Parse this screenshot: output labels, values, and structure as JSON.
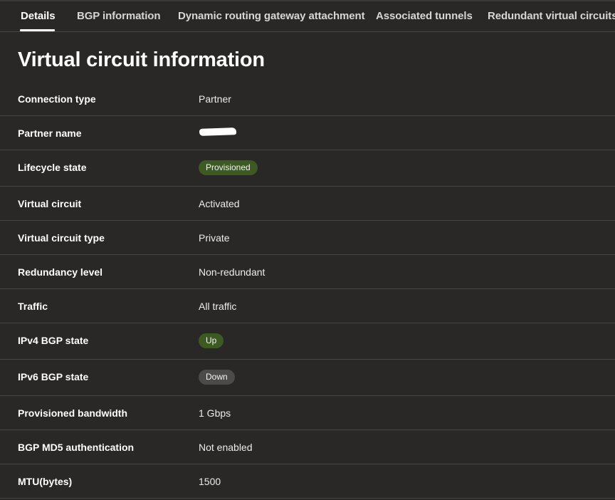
{
  "tabs": [
    {
      "label": "Details",
      "active": true
    },
    {
      "label": "BGP information"
    },
    {
      "label": "Dynamic routing gateway attachment"
    },
    {
      "label": "Associated tunnels"
    },
    {
      "label": "Redundant virtual circuits"
    }
  ],
  "section_title": "Virtual circuit information",
  "rows": [
    {
      "label": "Connection type",
      "value": "Partner"
    },
    {
      "label": "Partner name",
      "value": ""
    },
    {
      "label": "Lifecycle state",
      "value": "Provisioned"
    },
    {
      "label": "Virtual circuit",
      "value": "Activated"
    },
    {
      "label": "Virtual circuit type",
      "value": "Private"
    },
    {
      "label": "Redundancy level",
      "value": "Non-redundant"
    },
    {
      "label": "Traffic",
      "value": "All traffic"
    },
    {
      "label": "IPv4 BGP state",
      "value": "Up"
    },
    {
      "label": "IPv6 BGP state",
      "value": "Down"
    },
    {
      "label": "Provisioned bandwidth",
      "value": "1 Gbps"
    },
    {
      "label": "BGP MD5 authentication",
      "value": "Not enabled"
    },
    {
      "label": "MTU(bytes)",
      "value": "1500"
    }
  ],
  "colors": {
    "background": "#2a2826",
    "badge_green": "#3c5a22",
    "badge_gray": "#4d4b49",
    "divider": "#4a4744"
  }
}
